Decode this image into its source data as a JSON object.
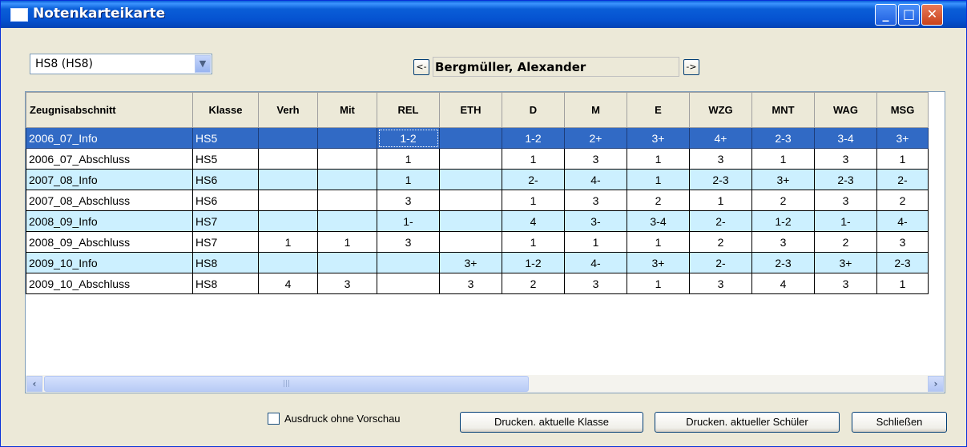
{
  "window": {
    "title": "Notenkarteikarte"
  },
  "class_select": {
    "value": "HS8  (HS8)"
  },
  "student_nav": {
    "prev_label": "<-",
    "next_label": "->",
    "student_name": "Bergmüller, Alexander"
  },
  "table": {
    "columns": [
      "Zeugnisabschnitt",
      "Klasse",
      "Verh",
      "Mit",
      "REL",
      "ETH",
      "D",
      "M",
      "E",
      "WZG",
      "MNT",
      "WAG",
      "MSG"
    ],
    "rows": [
      [
        "2006_07_Info",
        "HS5",
        "",
        "",
        "1-2",
        "",
        "1-2",
        "2+",
        "3+",
        "4+",
        "2-3",
        "3-4",
        "3+"
      ],
      [
        "2006_07_Abschluss",
        "HS5",
        "",
        "",
        "1",
        "",
        "1",
        "3",
        "1",
        "3",
        "1",
        "3",
        "1"
      ],
      [
        "2007_08_Info",
        "HS6",
        "",
        "",
        "1",
        "",
        "2-",
        "4-",
        "1",
        "2-3",
        "3+",
        "2-3",
        "2-"
      ],
      [
        "2007_08_Abschluss",
        "HS6",
        "",
        "",
        "3",
        "",
        "1",
        "3",
        "2",
        "1",
        "2",
        "3",
        "2"
      ],
      [
        "2008_09_Info",
        "HS7",
        "",
        "",
        "1-",
        "",
        "4",
        "3-",
        "3-4",
        "2-",
        "1-2",
        "1-",
        "4-"
      ],
      [
        "2008_09_Abschluss",
        "HS7",
        "1",
        "1",
        "3",
        "",
        "1",
        "1",
        "1",
        "2",
        "3",
        "2",
        "3"
      ],
      [
        "2009_10_Info",
        "HS8",
        "",
        "",
        "",
        "3+",
        "1-2",
        "4-",
        "3+",
        "2-",
        "2-3",
        "3+",
        "2-3"
      ],
      [
        "2009_10_Abschluss",
        "HS8",
        "4",
        "3",
        "",
        "3",
        "2",
        "3",
        "1",
        "3",
        "4",
        "3",
        "1"
      ]
    ],
    "selected_row": 0
  },
  "footer": {
    "checkbox_label": "Ausdruck ohne Vorschau",
    "print_class_label": "Drucken. aktuelle Klasse",
    "print_student_label": "Drucken. aktueller Schüler",
    "close_label": "Schließen"
  },
  "colors": {
    "row_alt": "#ccf0ff",
    "row_selected": "#316ac5",
    "title_bar": "#0a5ed8"
  }
}
